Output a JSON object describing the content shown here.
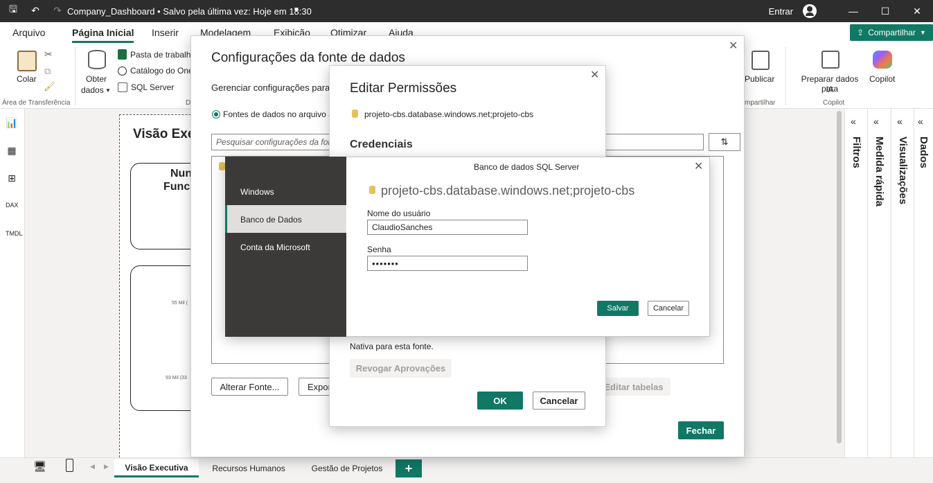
{
  "titlebar": {
    "title": "Company_Dashboard • Salvo pela última vez: Hoje em 18:30",
    "sign_in": "Entrar"
  },
  "ribbon_tabs": [
    "Arquivo",
    "Página Inicial",
    "Inserir",
    "Modelagem",
    "Exibição",
    "Otimizar",
    "Ajuda"
  ],
  "share": {
    "label": "Compartilhar"
  },
  "ribbon": {
    "paste": "Colar",
    "clipboard_group": "Área de Transferência",
    "get_data_1": "Obter",
    "get_data_2": "dados",
    "excel": "Pasta de trabalho",
    "onelake": "Catálogo do One",
    "sql": "SQL Server",
    "data_group_fragment": "D",
    "publish": "Publicar",
    "share_group": "mpartilhar",
    "prep_1": "Preparar dados para",
    "prep_2": "IA",
    "copilot": "Copilot",
    "copilot_group": "Copilot"
  },
  "canvas": {
    "page_title": "Visão Exe",
    "card1_line1": "Nun",
    "card1_line2": "Func",
    "mini1": "55 Mil (",
    "mini2": "93 Mil (33"
  },
  "panes": [
    "Filtros",
    "Medida rápida",
    "Visualizações",
    "Dados"
  ],
  "bottom_tabs": [
    "Visão Executiva",
    "Recursos Humanos",
    "Gestão de Projetos",
    "+"
  ],
  "dialog_config": {
    "title": "Configurações da fonte de dados",
    "subtitle": "Gerenciar configurações para",
    "radio_label": "Fontes de dados no arquivo a",
    "search_placeholder": "Pesquisar configurações da font",
    "change_source": "Alterar Fonte...",
    "export": "Expor",
    "edit_tables": "Editar tabelas",
    "close": "Fechar"
  },
  "dialog_permissions": {
    "title": "Editar Permissões",
    "source": "projeto-cbs.database.windows.net;projeto-cbs",
    "credentials_heading": "Credenciais",
    "native_text": "Nativa para esta fonte.",
    "revoke": "Revogar Aprovações",
    "ok": "OK",
    "cancel": "Cancelar"
  },
  "dialog_credentials": {
    "header": "Banco de dados SQL Server",
    "source": "projeto-cbs.database.windows.net;projeto-cbs",
    "nav": [
      "Windows",
      "Banco de Dados",
      "Conta da Microsoft"
    ],
    "username_label": "Nome do usuário",
    "username_value": "ClaudioSanches",
    "password_label": "Senha",
    "password_value": "•••••••",
    "save": "Salvar",
    "cancel": "Cancelar"
  }
}
